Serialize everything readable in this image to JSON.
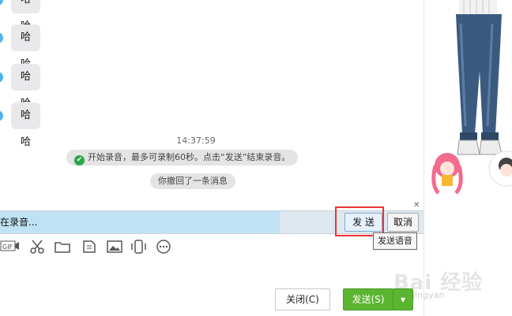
{
  "messages": [
    {
      "text": "哈哈"
    },
    {
      "text": "哈哈"
    },
    {
      "text": "哈哈"
    },
    {
      "text": "哈哈"
    }
  ],
  "timestamp": "14:37:59",
  "system_notes": {
    "recording": "开始录音，最多可录制60秒。点击“发送”结束录音。",
    "recalled": "你撤回了一条消息"
  },
  "record_bar": {
    "status_text": "在录音...",
    "progress": 0.66,
    "send_label": "发 送",
    "cancel_label": "取消",
    "tooltip": "发送语音"
  },
  "toolbar": {
    "gif_label": "GIF",
    "icons": [
      "gif-icon",
      "scissors-icon",
      "folder-icon",
      "screenshot-icon",
      "image-icon",
      "shake-icon",
      "more-icon"
    ]
  },
  "footer": {
    "close_label": "关闭(C)",
    "send_label": "发送(S)"
  },
  "watermark": {
    "text": "Bai 经验",
    "sub": "jingyan"
  },
  "colors": {
    "accent_green": "#5cb531",
    "highlight_red": "#e33333",
    "progress_blue": "#bfe3f5",
    "avatar_blue": "#4fb4ec"
  }
}
